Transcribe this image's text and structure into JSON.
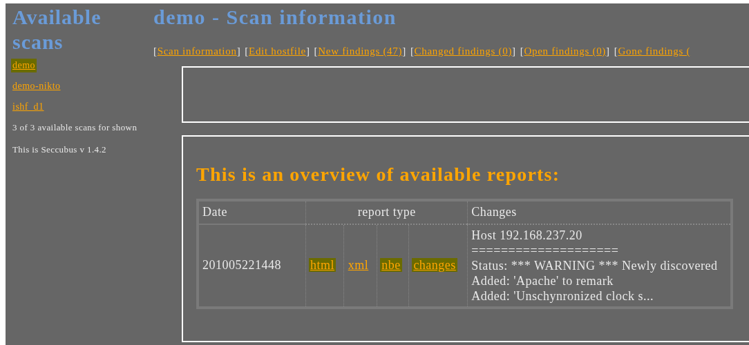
{
  "sidebar": {
    "title": "Available scans",
    "scans": [
      {
        "label": "demo",
        "highlighted": true
      },
      {
        "label": "demo-nikto",
        "highlighted": false
      },
      {
        "label": "ishf_d1",
        "highlighted": false
      }
    ],
    "count_note": "3 of 3 available scans for shown",
    "version_note": "This is Seccubus v 1.4.2"
  },
  "main": {
    "title": "demo - Scan information",
    "nav": [
      {
        "open": "[",
        "label": "Scan information",
        "close": "]"
      },
      {
        "open": "[",
        "label": "Edit hostfile",
        "close": "]"
      },
      {
        "open": "[",
        "label": "New findings (47)",
        "close": "]"
      },
      {
        "open": "[",
        "label": "Changed findings (0)",
        "close": "]"
      },
      {
        "open": "[",
        "label": "Open findings (0)",
        "close": "]"
      },
      {
        "open": "[",
        "label": "Gone findings ("
      }
    ],
    "reports": {
      "heading": "This is an overview of available reports:",
      "columns": [
        "Date",
        "report type",
        "Changes"
      ],
      "rows": [
        {
          "date": "201005221448",
          "links": [
            {
              "label": "html",
              "highlighted": true
            },
            {
              "label": "xml",
              "highlighted": false
            },
            {
              "label": "nbe",
              "highlighted": true
            },
            {
              "label": "changes",
              "highlighted": true
            }
          ],
          "changes": [
            "Host 192.168.237.20",
            "====================",
            "Status: *** WARNING *** Newly discovered",
            "Added: 'Apache' to remark",
            "Added: 'Unschynronized clock s..."
          ]
        }
      ]
    }
  }
}
